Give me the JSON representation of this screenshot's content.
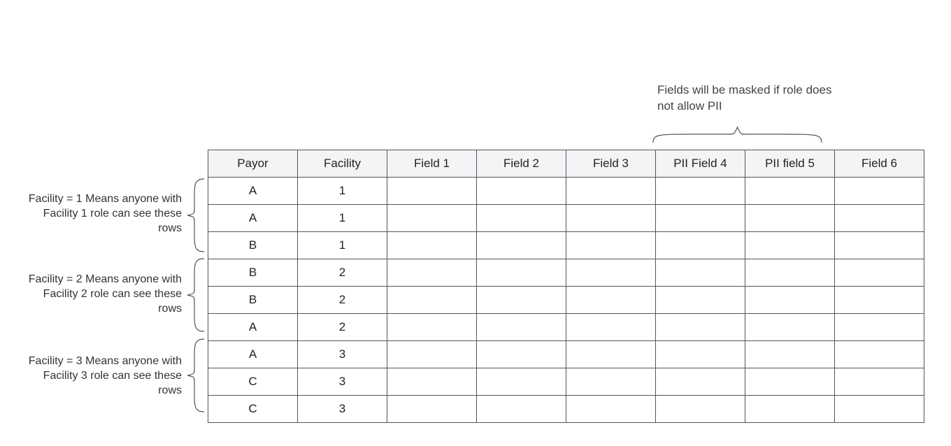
{
  "annotations": {
    "pii": "Fields will be masked if role does not allow PII",
    "group1": "Facility = 1 Means anyone with Facility 1 role can see these rows",
    "group2": "Facility = 2 Means anyone with Facility 2 role can see these rows",
    "group3": "Facility = 3 Means anyone with Facility 3 role can see these rows"
  },
  "headers": {
    "c0": "Payor",
    "c1": "Facility",
    "c2": "Field 1",
    "c3": "Field 2",
    "c4": "Field 3",
    "c5": "PII Field 4",
    "c6": "PII field 5",
    "c7": "Field 6"
  },
  "rows": {
    "r0": {
      "payor": "A",
      "facility": "1"
    },
    "r1": {
      "payor": "A",
      "facility": "1"
    },
    "r2": {
      "payor": "B",
      "facility": "1"
    },
    "r3": {
      "payor": "B",
      "facility": "2"
    },
    "r4": {
      "payor": "B",
      "facility": "2"
    },
    "r5": {
      "payor": "A",
      "facility": "2"
    },
    "r6": {
      "payor": "A",
      "facility": "3"
    },
    "r7": {
      "payor": "C",
      "facility": "3"
    },
    "r8": {
      "payor": "C",
      "facility": "3"
    }
  }
}
